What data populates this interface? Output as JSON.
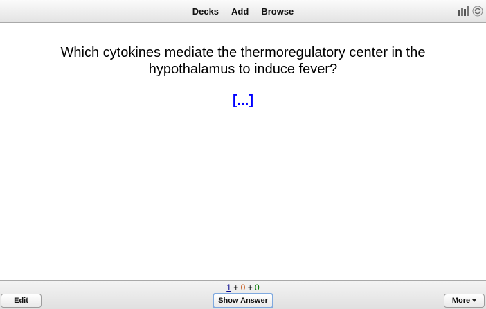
{
  "toolbar": {
    "decks_label": "Decks",
    "add_label": "Add",
    "browse_label": "Browse",
    "icons": [
      "stats-icon",
      "sync-icon"
    ]
  },
  "card": {
    "question": "Which cytokines mediate the thermoregulatory center in the hypothalamus to induce fever?",
    "cloze": "[...]"
  },
  "counts": {
    "new": "1",
    "plus1": "+",
    "learn": "0",
    "plus2": "+",
    "review": "0"
  },
  "bottom": {
    "edit_label": "Edit",
    "show_answer_label": "Show Answer",
    "more_label": "More"
  },
  "colors": {
    "cloze": "#0000ff",
    "new_count": "#00008b",
    "learn_count": "#c35617",
    "review_count": "#007700"
  }
}
